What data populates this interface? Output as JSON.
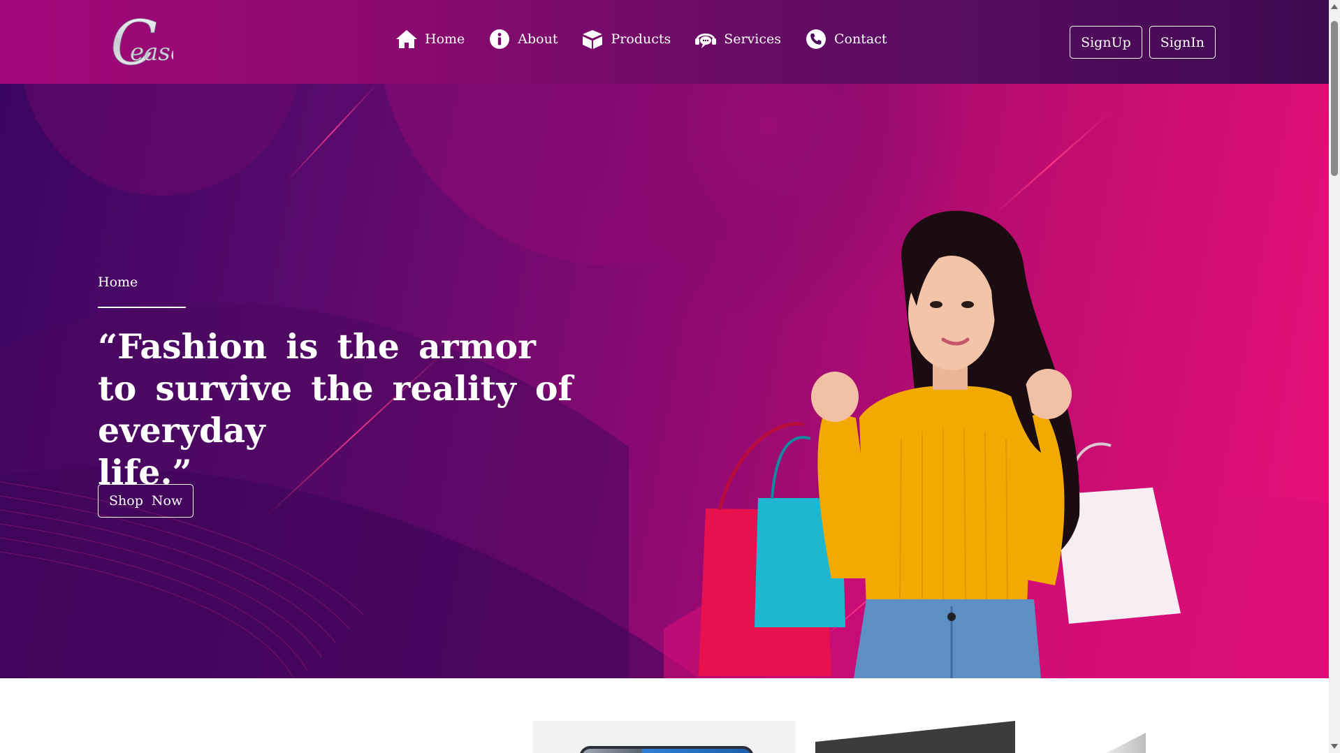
{
  "brand": {
    "name": "Ceasor",
    "logo_letter": "C",
    "logo_rest": "easor"
  },
  "nav": {
    "items": [
      {
        "label": "Home",
        "icon": "home-icon"
      },
      {
        "label": "About",
        "icon": "info-icon"
      },
      {
        "label": "Products",
        "icon": "box-icon"
      },
      {
        "label": "Services",
        "icon": "chat-support-icon"
      },
      {
        "label": "Contact",
        "icon": "phone-icon"
      }
    ]
  },
  "auth": {
    "signup_label": "SignUp",
    "signin_label": "SignIn"
  },
  "hero": {
    "breadcrumb": "Home",
    "quote_line1": "“Fashion is the armor",
    "quote_line2": "to survive the reality of everyday",
    "quote_line3": "life.”",
    "cta_label": "Shop Now"
  },
  "colors": {
    "nav_start": "#a3087a",
    "nav_end": "#3f0a52",
    "hero_dark": "#3b0660",
    "hero_pink": "#e8107a",
    "sweater": "#f2a900",
    "jeans": "#5c8fc4"
  }
}
